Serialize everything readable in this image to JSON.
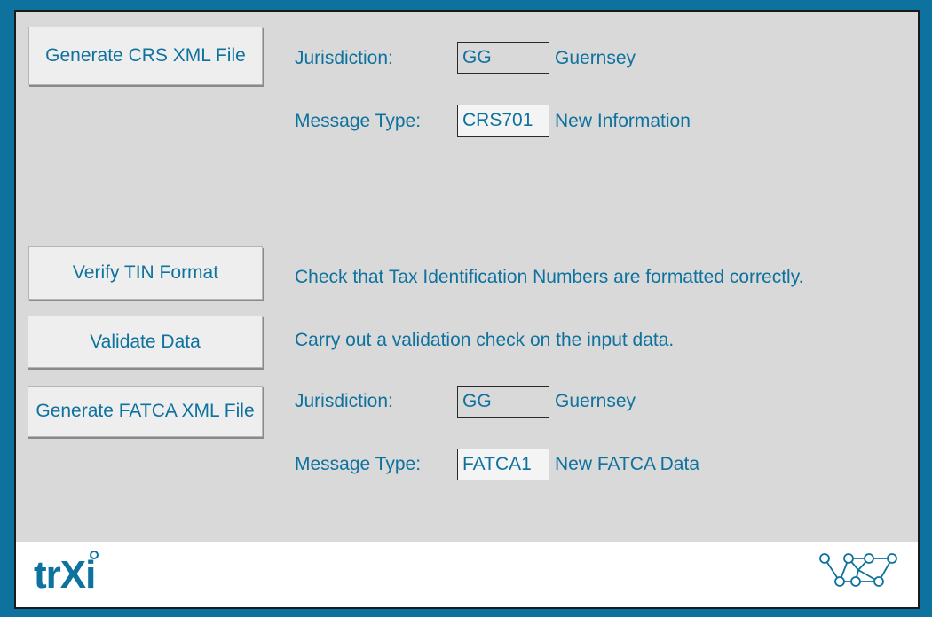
{
  "buttons": {
    "generate_crs": "Generate CRS XML File",
    "verify_tin": "Verify TIN Format",
    "validate_data": "Validate Data",
    "generate_fatca": "Generate FATCA XML File"
  },
  "crs": {
    "jurisdiction_label": "Jurisdiction:",
    "jurisdiction_code": "GG",
    "jurisdiction_name": "Guernsey",
    "message_type_label": "Message Type:",
    "message_type_code": "CRS701",
    "message_type_desc": "New Information"
  },
  "descriptions": {
    "verify_tin": "Check that Tax Identification Numbers are formatted correctly.",
    "validate_data": "Carry out a validation check on the input data."
  },
  "fatca": {
    "jurisdiction_label": "Jurisdiction:",
    "jurisdiction_code": "GG",
    "jurisdiction_name": "Guernsey",
    "message_type_label": "Message Type:",
    "message_type_code": "FATCA1",
    "message_type_desc": "New FATCA Data"
  },
  "footer": {
    "logo_text": "trXi",
    "network_logo_icon": "network-nodes-icon"
  },
  "colors": {
    "brand": "#0e729e",
    "panel_background": "#d9d9d9",
    "button_background": "#eeeeee"
  }
}
